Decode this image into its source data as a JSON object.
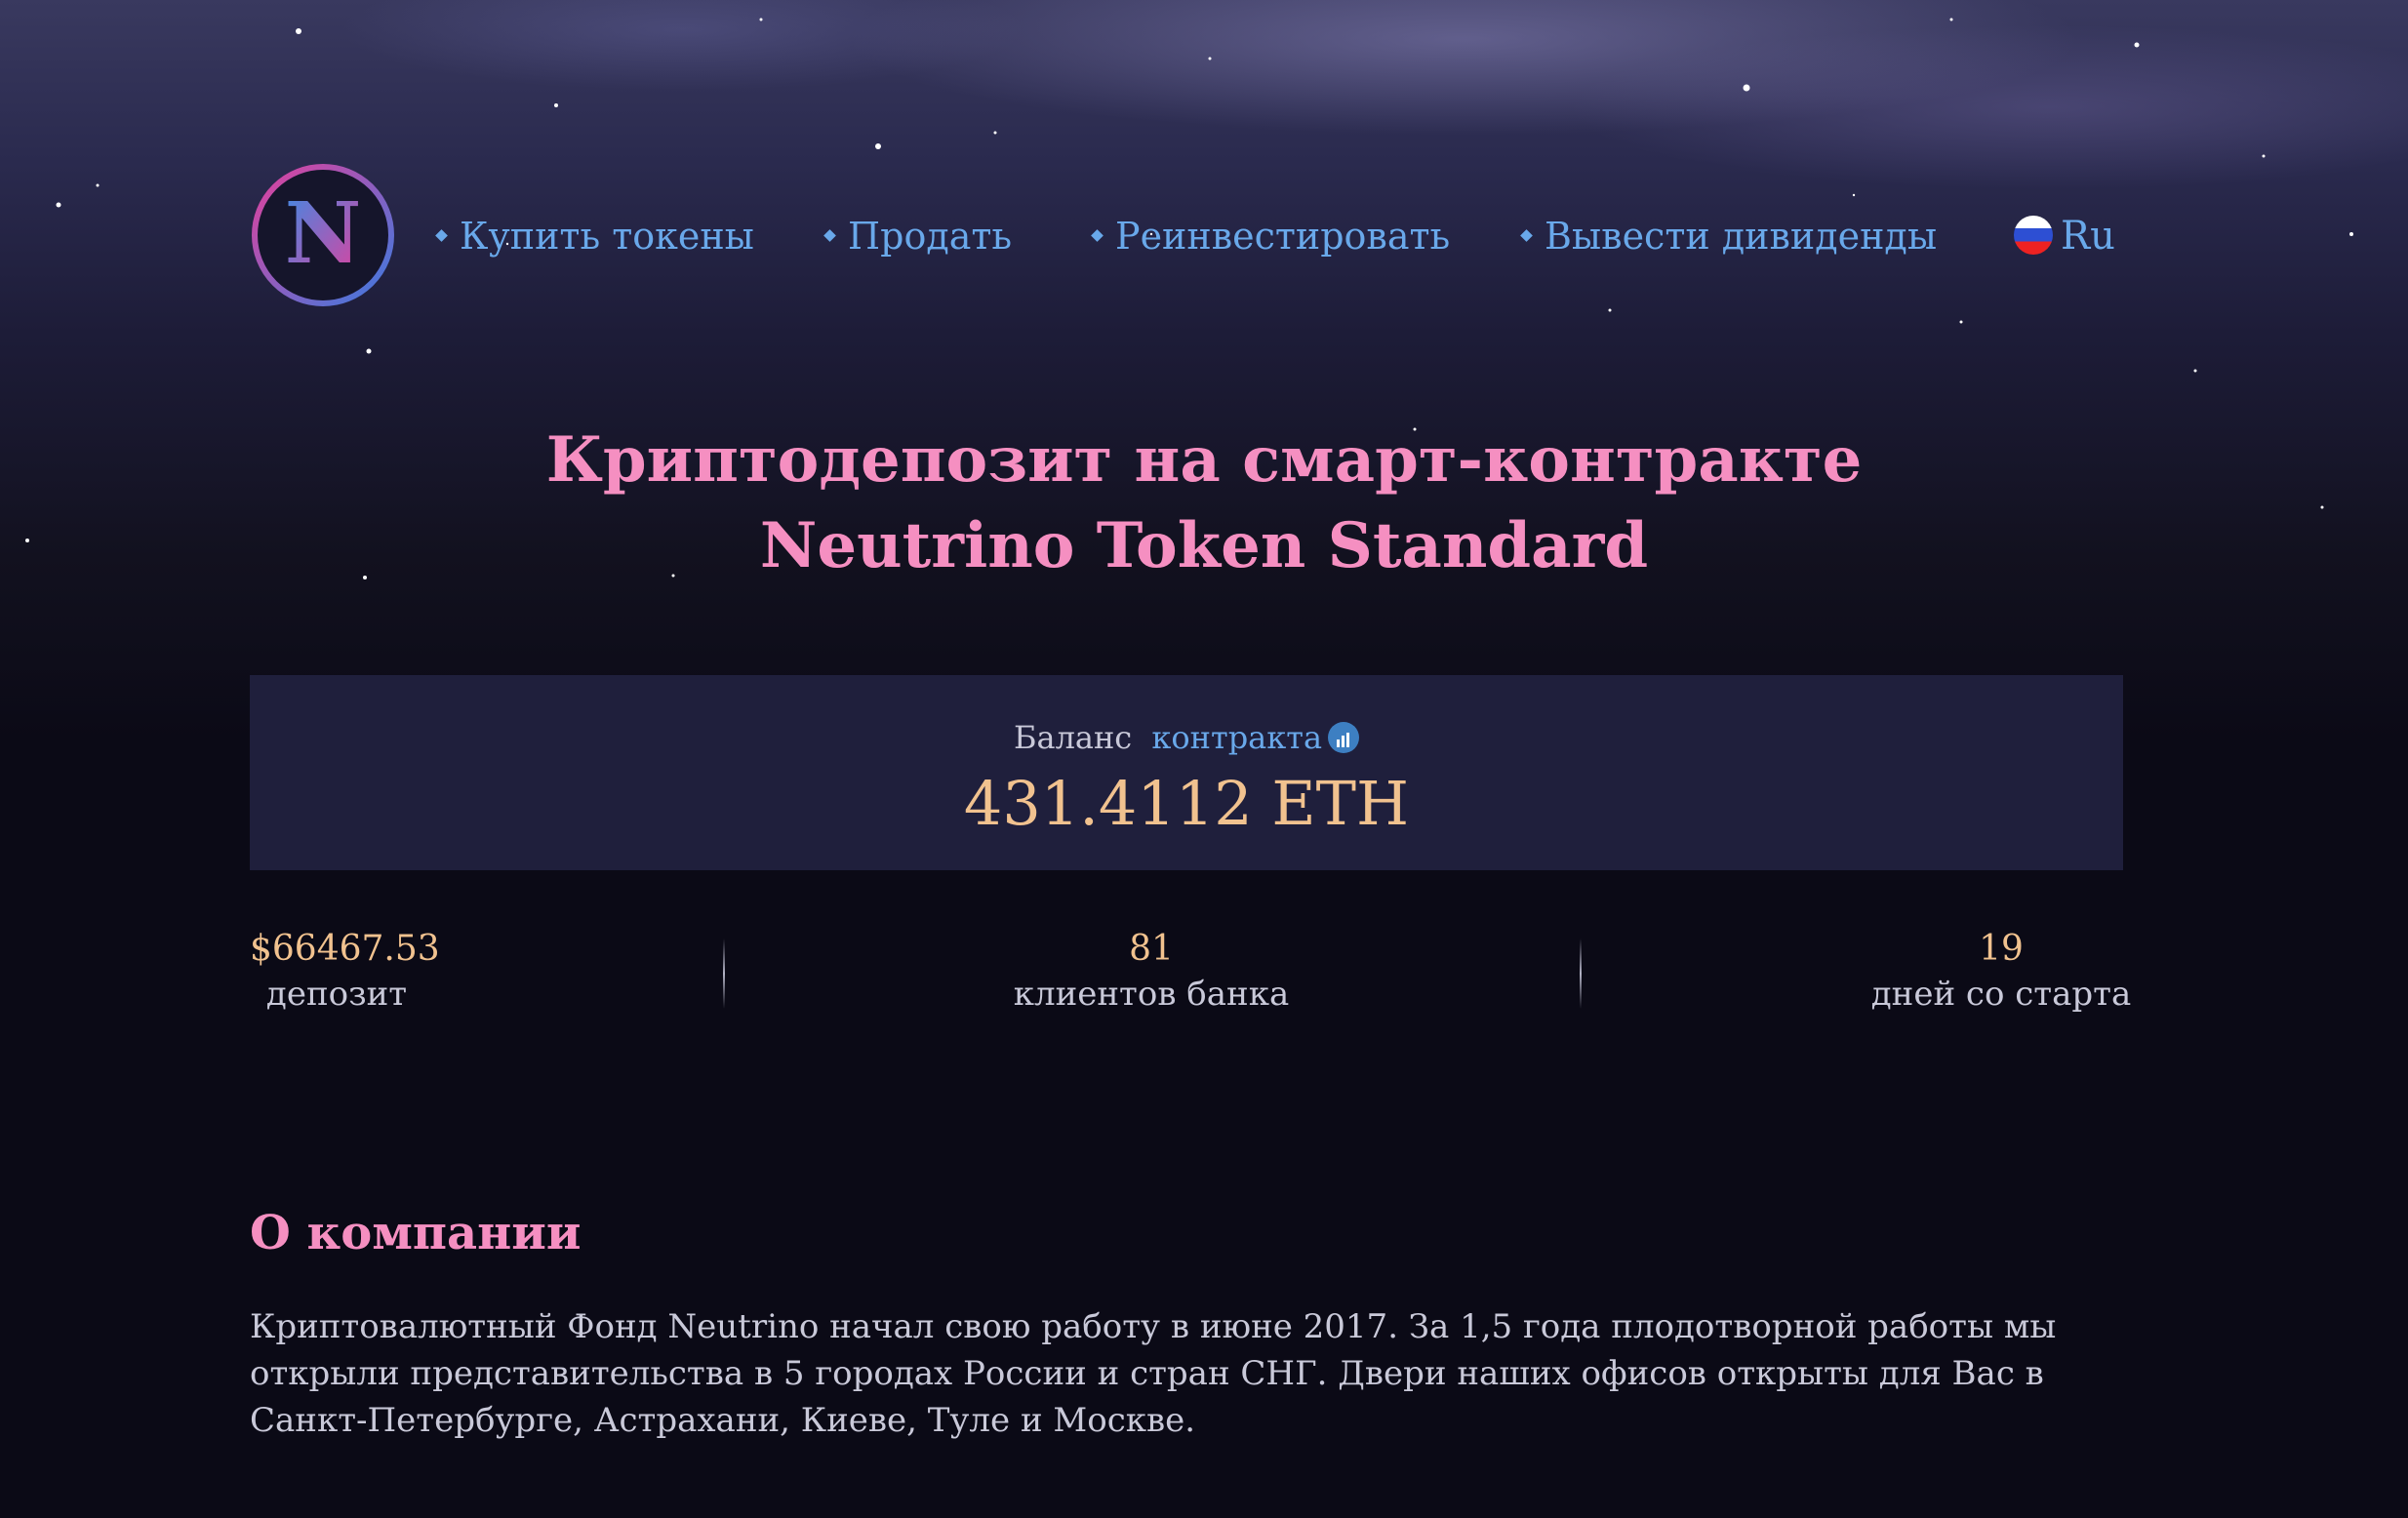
{
  "header": {
    "logo_letter": "N",
    "nav": [
      {
        "label": "Купить токены"
      },
      {
        "label": "Продать"
      },
      {
        "label": "Реинвестировать"
      },
      {
        "label": "Вывести дивиденды"
      }
    ],
    "language": {
      "label": "Ru",
      "icon": "russia-flag-icon"
    }
  },
  "hero": {
    "title_line1": "Криптодепозит на смарт-контракте",
    "title_line2": "Neutrino Token Standard"
  },
  "balance": {
    "label": "Баланс",
    "link_label": "контракта",
    "link_icon": "chart-icon",
    "value": "431.4112 ETH"
  },
  "stats": [
    {
      "value": "$66467.53",
      "label": "депозит"
    },
    {
      "value": "81",
      "label": "клиентов банка"
    },
    {
      "value": "19",
      "label": "дней со старта"
    }
  ],
  "about": {
    "title": "О компании",
    "text": "Криптовалютный Фонд Neutrino начал свою работу в июне 2017. За 1,5 года плодотворной работы мы открыли представительства в 5 городах России и стран СНГ. Двери наших офисов открыты для Вас в Санкт-Петербурге, Астрахани, Киеве, Туле и Москве."
  },
  "colors": {
    "accent_pink": "#f58fc1",
    "link_blue": "#69a8ea",
    "value_gold": "#f1c28f",
    "background": "#0b0a16"
  }
}
